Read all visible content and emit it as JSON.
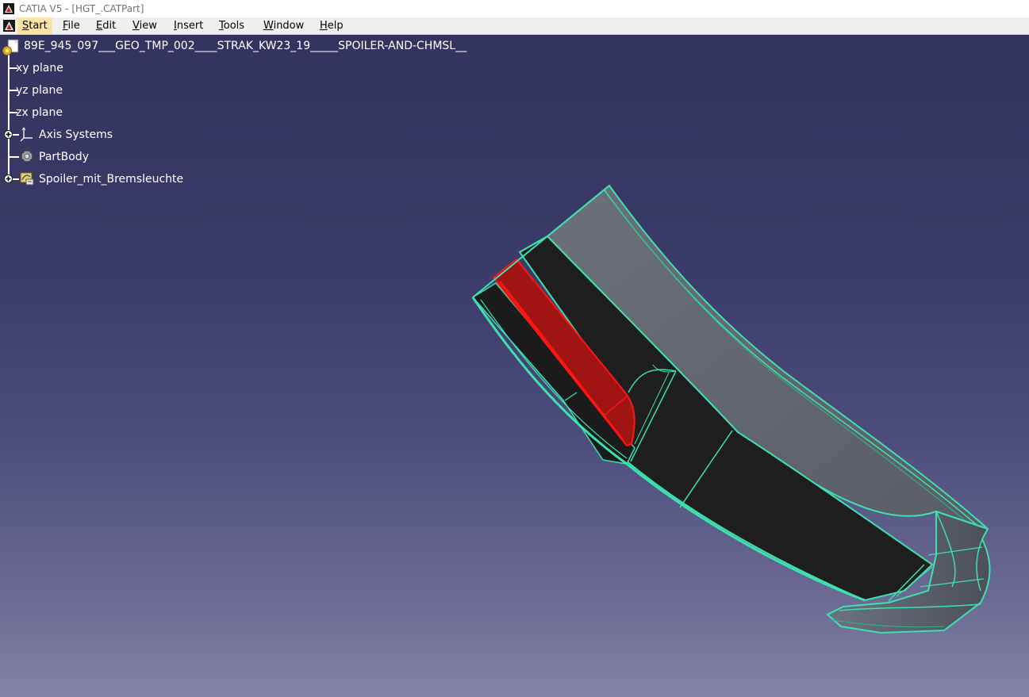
{
  "window": {
    "title": "CATIA V5 - [HGT_.CATPart]"
  },
  "menubar": {
    "items": [
      {
        "label": "Start",
        "accel": "S",
        "rest": "tart",
        "active": true
      },
      {
        "label": "File",
        "accel": "F",
        "rest": "ile",
        "active": false
      },
      {
        "label": "Edit",
        "accel": "E",
        "rest": "dit",
        "active": false
      },
      {
        "label": "View",
        "accel": "V",
        "rest": "iew",
        "active": false
      },
      {
        "label": "Insert",
        "accel": "I",
        "rest": "nsert",
        "active": false
      },
      {
        "label": "Tools",
        "accel": "T",
        "rest": "ools",
        "active": false
      },
      {
        "label": "Window",
        "accel": "W",
        "rest": "indow",
        "active": false
      },
      {
        "label": "Help",
        "accel": "H",
        "rest": "elp",
        "active": false
      }
    ],
    "highlight_color": "#fbe3a6"
  },
  "tree": {
    "root": {
      "label": "89E_945_097___GEO_TMP_002____STRAK_KW23_19_____SPOILER-AND-CHMSL__",
      "icon": "part-icon"
    },
    "children": [
      {
        "label": "xy plane",
        "icon": "plane-icon",
        "expandable": false
      },
      {
        "label": "yz plane",
        "icon": "plane-icon",
        "expandable": false
      },
      {
        "label": "zx plane",
        "icon": "plane-icon",
        "expandable": false
      },
      {
        "label": "Axis Systems",
        "icon": "axis-system-icon",
        "expandable": true
      },
      {
        "label": "PartBody",
        "icon": "part-body-icon",
        "expandable": false
      },
      {
        "label": "Spoiler_mit_Bremsleuchte",
        "icon": "geometrical-set-icon",
        "expandable": true
      }
    ]
  },
  "viewport": {
    "background_top": "#33335f",
    "background_bottom": "#8484a8",
    "edge_color": "#3ee0b0",
    "highlight_color": "#ff1414",
    "surface_dark": "#1e1e1e",
    "surface_gray": "#5f6670"
  }
}
